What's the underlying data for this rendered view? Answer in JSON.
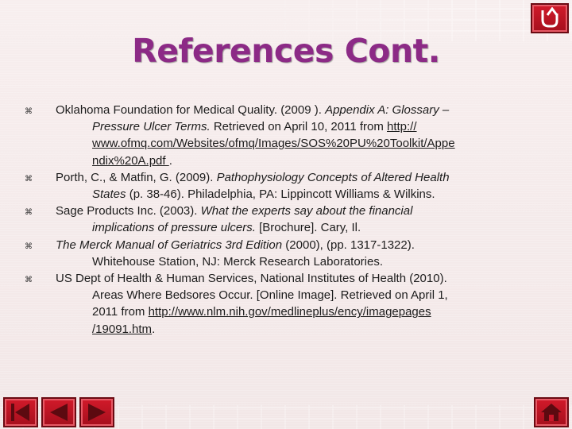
{
  "slide": {
    "title": "References Cont."
  },
  "references": [
    {
      "lines": [
        {
          "parts": [
            {
              "text": "Oklahoma Foundation for Medical Quality. (2009 ). ",
              "style": "normal"
            },
            {
              "text": "Appendix A: Glossary –",
              "style": "italic"
            }
          ]
        },
        {
          "parts": [
            {
              "text": "Pressure Ulcer Terms.",
              "style": "italic"
            },
            {
              "text": "  Retrieved on April 10, 2011 from  ",
              "style": "normal"
            },
            {
              "text": "http://",
              "style": "link"
            }
          ]
        },
        {
          "parts": [
            {
              "text": "www.ofmq.com/Websites/ofmq/Images/SOS%20PU%20Toolkit/Appe",
              "style": "link"
            }
          ]
        },
        {
          "parts": [
            {
              "text": "ndix%20A.pdf ",
              "style": "link"
            },
            {
              "text": ".",
              "style": "normal"
            }
          ]
        }
      ]
    },
    {
      "lines": [
        {
          "parts": [
            {
              "text": "Porth, C., & Matfin, G. (2009). ",
              "style": "normal"
            },
            {
              "text": "Pathophysiology Concepts of Altered Health",
              "style": "italic"
            }
          ]
        },
        {
          "parts": [
            {
              "text": "States",
              "style": "italic"
            },
            {
              "text": " (p. 38-46).  Philadelphia, PA: Lippincott Williams & Wilkins.",
              "style": "normal"
            }
          ]
        }
      ]
    },
    {
      "lines": [
        {
          "parts": [
            {
              "text": "Sage Products Inc. (2003). ",
              "style": "normal"
            },
            {
              "text": "What the experts say about the financial",
              "style": "italic"
            }
          ]
        },
        {
          "parts": [
            {
              "text": "implications of pressure ulcers.",
              "style": "italic"
            },
            {
              "text": " [Brochure]. Cary, Il.",
              "style": "normal"
            }
          ]
        }
      ]
    },
    {
      "lines": [
        {
          "parts": [
            {
              "text": "The Merck Manual of Geriatrics 3rd Edition",
              "style": "italic"
            },
            {
              "text": " (2000), (pp. 1317-1322).",
              "style": "normal"
            }
          ]
        },
        {
          "parts": [
            {
              "text": "Whitehouse Station, NJ: Merck Research Laboratories.",
              "style": "normal"
            }
          ]
        }
      ]
    },
    {
      "lines": [
        {
          "parts": [
            {
              "text": "US Dept of Health & Human Services, National Institutes of Health (2010).",
              "style": "normal"
            }
          ]
        },
        {
          "parts": [
            {
              "text": "Areas Where Bedsores Occur. [Online Image]. Retrieved on April 1,",
              "style": "normal"
            }
          ]
        },
        {
          "parts": [
            {
              "text": "2011 from ",
              "style": "normal"
            },
            {
              "text": "http://www.nlm.nih.gov/medlineplus/ency/imagepages",
              "style": "link"
            }
          ]
        },
        {
          "parts": [
            {
              "text": "/19091.htm",
              "style": "link"
            },
            {
              "text": ".",
              "style": "normal"
            }
          ]
        }
      ]
    }
  ],
  "icons": {
    "bullet": "wingding-bullet-icon",
    "return": "return-arrow-icon",
    "first": "first-slide-icon",
    "prev": "previous-slide-icon",
    "next": "next-slide-icon",
    "home": "home-icon"
  },
  "colors": {
    "title": "#8c2a86",
    "button": "#c8172a",
    "background": "#f5ecec"
  }
}
